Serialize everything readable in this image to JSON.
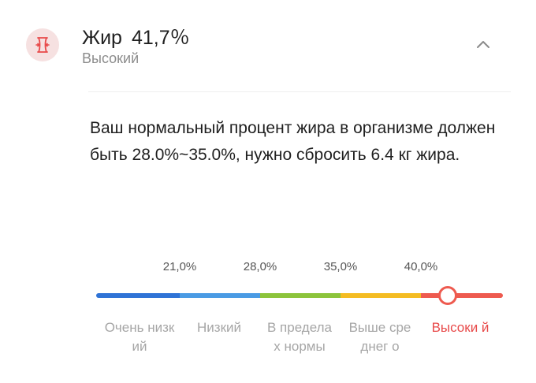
{
  "header": {
    "title": "Жир",
    "value": "41,7％",
    "status": "Высокий"
  },
  "description": "Ваш нормальный процент жира в организме должен быть 28.0%~35.0%, нужно сбросить 6.4 кг жира.",
  "scale": {
    "current_value_percent": 41.7,
    "ticks": [
      "21,0%",
      "28,0%",
      "35,0%",
      "40,0%"
    ],
    "categories": [
      {
        "label": "Очень низкий",
        "color": "#2f73d6"
      },
      {
        "label": "Низкий",
        "color": "#4a9be4"
      },
      {
        "label": "В предела х нормы",
        "color": "#8cc43b"
      },
      {
        "label": "Выше среднег о",
        "color": "#f4bc22"
      },
      {
        "label": "Высоки й",
        "color": "#ee5a4f"
      }
    ],
    "active_category_index": 4
  },
  "colors": {
    "accent": "#e84a4a",
    "icon_background": "#f6e1e1"
  },
  "icons": {
    "metric": "body-fat-icon",
    "collapse": "chevron-up-icon"
  }
}
